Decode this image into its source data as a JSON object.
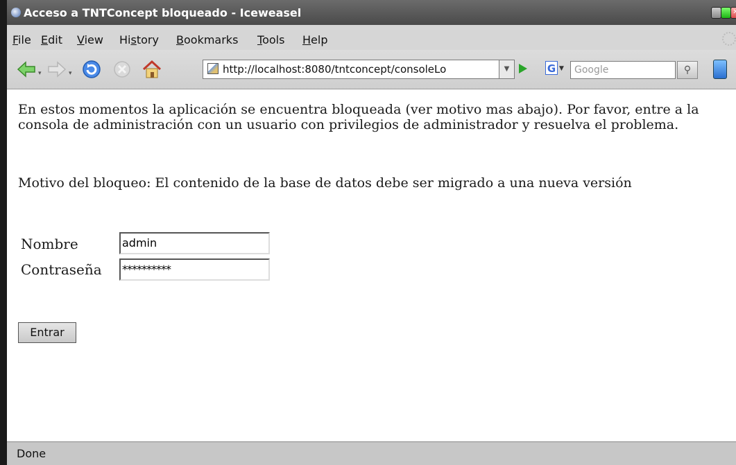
{
  "window": {
    "title": "Acceso a TNTConcept bloqueado - Iceweasel"
  },
  "menu": {
    "items": [
      {
        "label": "File",
        "accel": "F"
      },
      {
        "label": "Edit",
        "accel": "E"
      },
      {
        "label": "View",
        "accel": "V"
      },
      {
        "label": "History",
        "accel": "s"
      },
      {
        "label": "Bookmarks",
        "accel": "B"
      },
      {
        "label": "Tools",
        "accel": "T"
      },
      {
        "label": "Help",
        "accel": "H"
      }
    ]
  },
  "toolbar": {
    "url": "http://localhost:8080/tntconcept/consoleLo",
    "search_placeholder": "Google",
    "search_engine_letter": "G",
    "icons": [
      "back-icon",
      "forward-icon",
      "reload-icon",
      "stop-icon",
      "home-icon",
      "go-icon",
      "search-icon",
      "bookmark-icon"
    ]
  },
  "content": {
    "message": "En estos momentos la aplicación se encuentra bloqueada (ver motivo mas abajo). Por favor, entre a la consola de administración con un usuario con privilegios de administrador y resuelva el problema.",
    "reason": "Motivo del bloqueo: El contenido de la base de datos debe ser migrado a una nueva versión",
    "form": {
      "name_label": "Nombre",
      "name_value": "admin",
      "password_label": "Contraseña",
      "password_value": "**********",
      "submit_label": "Entrar"
    }
  },
  "status": {
    "text": "Done"
  },
  "colors": {
    "titlebar": "#555555",
    "chrome": "#d6d6d6",
    "content_bg": "#ffffff",
    "go_green": "#2aa52a"
  }
}
